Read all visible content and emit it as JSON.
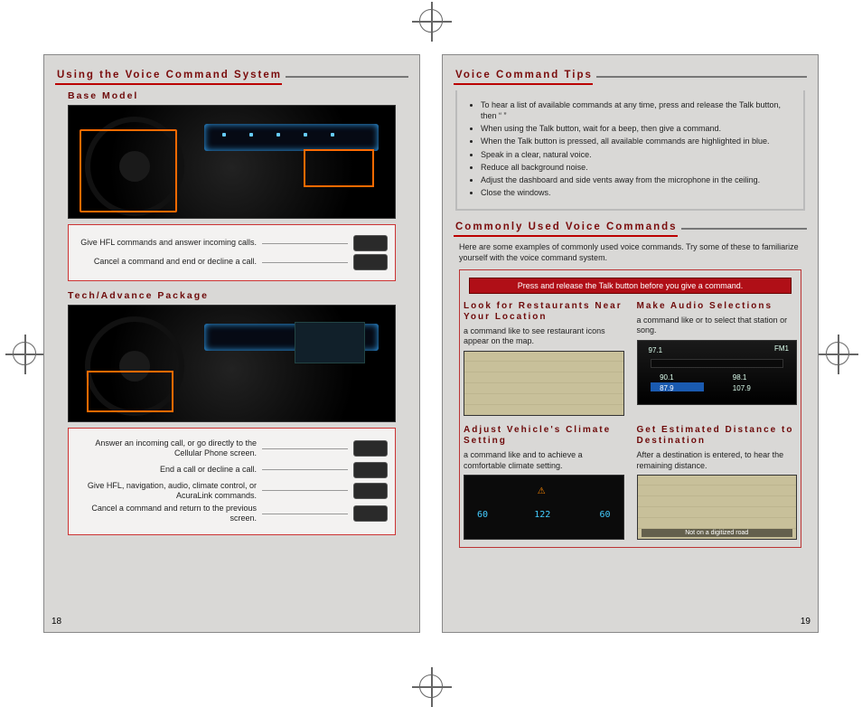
{
  "left": {
    "heading": "Using the Voice Command System",
    "base_heading": "Base Model",
    "base_callouts": [
      "Give HFL commands and answer incoming calls.",
      "Cancel a command and end or decline a call."
    ],
    "tech_heading": "Tech/Advance Package",
    "tech_callouts": [
      "Answer an incoming call, or go directly to the Cellular Phone screen.",
      "End a call or decline a call.",
      "Give HFL, navigation, audio, climate control, or AcuraLink commands.",
      "Cancel a command and return to the previous screen."
    ],
    "page_num": "18"
  },
  "right": {
    "tips_heading": "Voice Command Tips",
    "tips": [
      "To hear a list of available commands at any time, press and release the Talk button, then “ ”",
      "When using the Talk button, wait for a beep, then give a command.",
      "When the Talk button is pressed, all available commands are highlighted in blue.",
      "Speak in a clear, natural voice.",
      "Reduce all background noise.",
      "Adjust the dashboard and side vents away from the microphone in the ceiling.",
      "Close the windows."
    ],
    "commands_heading": "Commonly Used Voice Commands",
    "intro": "Here are some examples of commonly used voice commands. Try some of these to familiarize yourself with the voice command system.",
    "red_strip": "Press and release the Talk button before you give a command.",
    "blocks": [
      {
        "title": "Look for Restaurants Near Your Location",
        "text": "a command like to see restaurant icons appear on the map."
      },
      {
        "title": "Make Audio Selections",
        "text": "a command like or to select that station or song."
      },
      {
        "title": "Adjust Vehicle's Climate Setting",
        "text": "a command like and to achieve a comfortable climate setting."
      },
      {
        "title": "Get Estimated Distance to Destination",
        "text": "After a destination is entered, to hear the remaining distance."
      }
    ],
    "radio": {
      "fm1": "FM1",
      "freq": "97.1",
      "p1": "90.1",
      "p2": "98.1",
      "p3": "87.9",
      "p4": "107.9"
    },
    "climate": {
      "l": "60",
      "c": "122",
      "r": "60"
    },
    "page_num": "19"
  }
}
